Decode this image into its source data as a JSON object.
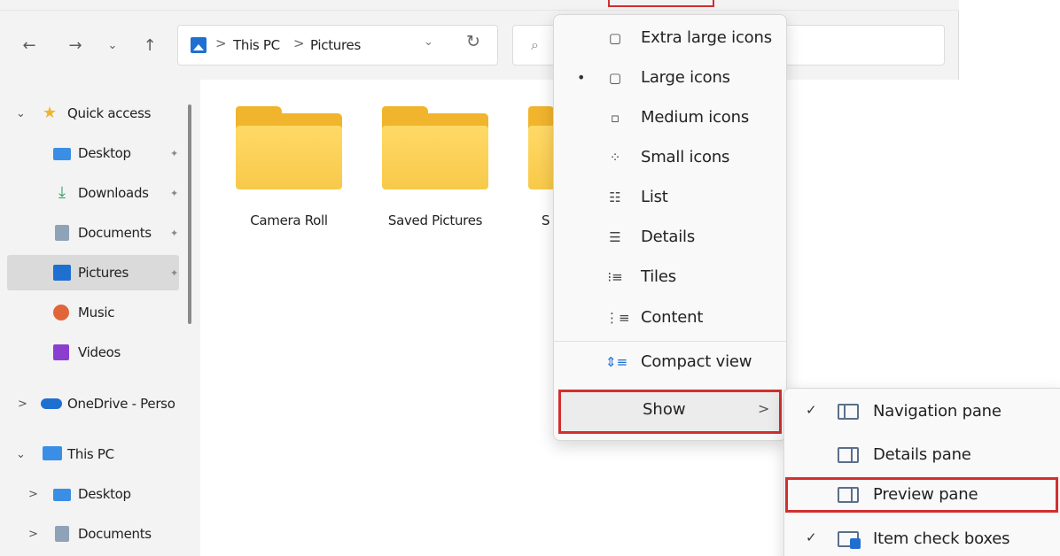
{
  "address_bar": {
    "crumbs": [
      "This PC",
      "Pictures"
    ],
    "separator": ">"
  },
  "nav": {
    "back_icon": "←",
    "forward_icon": "→",
    "recent_icon": "⌄",
    "up_icon": "↑",
    "refresh_icon": "↻",
    "dropdown_icon": "⌄",
    "search_icon": "⌕"
  },
  "sidebar": {
    "items": [
      {
        "label": "Quick access",
        "icon": "star-icon",
        "chevron": "⌄"
      },
      {
        "label": "Desktop",
        "icon": "desktop-icon",
        "pinned": true
      },
      {
        "label": "Downloads",
        "icon": "download-icon",
        "pinned": true
      },
      {
        "label": "Documents",
        "icon": "documents-icon",
        "pinned": true
      },
      {
        "label": "Pictures",
        "icon": "pictures-icon",
        "pinned": true,
        "selected": true
      },
      {
        "label": "Music",
        "icon": "music-icon"
      },
      {
        "label": "Videos",
        "icon": "videos-icon"
      },
      {
        "label": "OneDrive - Perso",
        "icon": "cloud-icon",
        "chevron": ">"
      },
      {
        "label": "This PC",
        "icon": "pc-icon",
        "chevron": "⌄"
      },
      {
        "label": "Desktop",
        "icon": "desktop-icon",
        "chevron": ">"
      },
      {
        "label": "Documents",
        "icon": "documents-icon",
        "chevron": ">"
      }
    ],
    "pin_glyph": "📌"
  },
  "content": {
    "folders": [
      {
        "label": "Camera Roll"
      },
      {
        "label": "Saved Pictures"
      },
      {
        "label": "S"
      }
    ]
  },
  "view_menu": {
    "items": [
      {
        "label": "Extra large icons",
        "icon": "extra-large-icons-icon"
      },
      {
        "label": "Large icons",
        "icon": "large-icons-icon",
        "selected": true
      },
      {
        "label": "Medium icons",
        "icon": "medium-icons-icon"
      },
      {
        "label": "Small icons",
        "icon": "small-icons-icon"
      },
      {
        "label": "List",
        "icon": "list-icon"
      },
      {
        "label": "Details",
        "icon": "details-icon"
      },
      {
        "label": "Tiles",
        "icon": "tiles-icon"
      },
      {
        "label": "Content",
        "icon": "content-icon"
      },
      {
        "label": "Compact view",
        "icon": "compact-view-icon"
      }
    ],
    "bullet": "•",
    "show_label": "Show",
    "show_arrow": ">"
  },
  "show_submenu": {
    "items": [
      {
        "label": "Navigation pane",
        "checked": true
      },
      {
        "label": "Details pane",
        "checked": false
      },
      {
        "label": "Preview pane",
        "checked": false
      },
      {
        "label": "Item check boxes",
        "checked": true
      }
    ],
    "check_glyph": "✓"
  },
  "colors": {
    "highlight": "#d32f2f",
    "folder": "#f0b42d",
    "accent": "#1f6fd1"
  }
}
